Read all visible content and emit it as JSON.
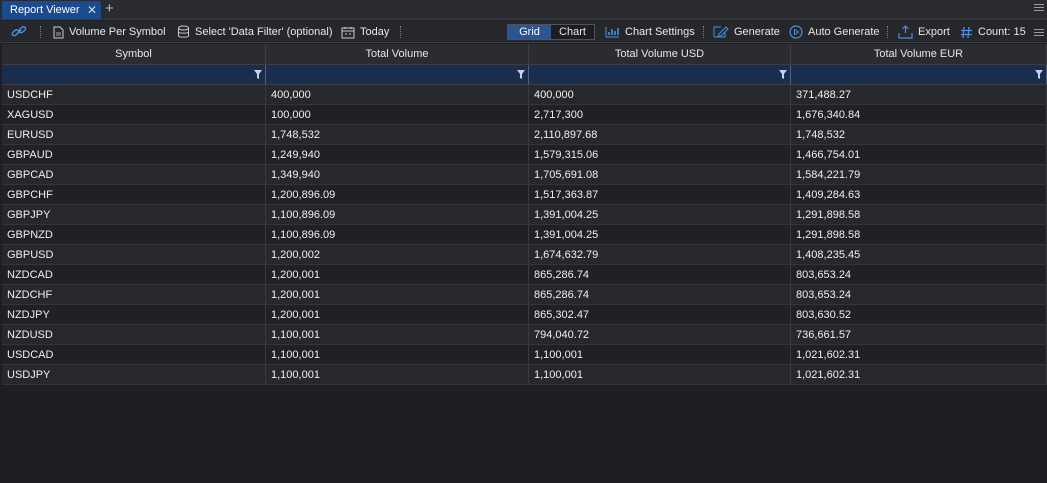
{
  "tabs": [
    {
      "label": "Report Viewer"
    }
  ],
  "toolbar": {
    "report_label": "Volume Per Symbol",
    "filter_label": "Select 'Data Filter' (optional)",
    "date_label": "Today",
    "view_grid": "Grid",
    "view_chart": "Chart",
    "chart_settings": "Chart Settings",
    "generate": "Generate",
    "auto_generate": "Auto Generate",
    "export": "Export",
    "count_label": "Count: 15"
  },
  "colors": {
    "accent": "#2c5392",
    "filter_row": "#1b2d4f",
    "icon_blue": "#4a90e2"
  },
  "table": {
    "columns": [
      "Symbol",
      "Total Volume",
      "Total Volume USD",
      "Total Volume EUR"
    ],
    "rows": [
      [
        "USDCHF",
        "400,000",
        "400,000",
        "371,488.27"
      ],
      [
        "XAGUSD",
        "100,000",
        "2,717,300",
        "1,676,340.84"
      ],
      [
        "EURUSD",
        "1,748,532",
        "2,110,897.68",
        "1,748,532"
      ],
      [
        "GBPAUD",
        "1,249,940",
        "1,579,315.06",
        "1,466,754.01"
      ],
      [
        "GBPCAD",
        "1,349,940",
        "1,705,691.08",
        "1,584,221.79"
      ],
      [
        "GBPCHF",
        "1,200,896.09",
        "1,517,363.87",
        "1,409,284.63"
      ],
      [
        "GBPJPY",
        "1,100,896.09",
        "1,391,004.25",
        "1,291,898.58"
      ],
      [
        "GBPNZD",
        "1,100,896.09",
        "1,391,004.25",
        "1,291,898.58"
      ],
      [
        "GBPUSD",
        "1,200,002",
        "1,674,632.79",
        "1,408,235.45"
      ],
      [
        "NZDCAD",
        "1,200,001",
        "865,286.74",
        "803,653.24"
      ],
      [
        "NZDCHF",
        "1,200,001",
        "865,286.74",
        "803,653.24"
      ],
      [
        "NZDJPY",
        "1,200,001",
        "865,302.47",
        "803,630.52"
      ],
      [
        "NZDUSD",
        "1,100,001",
        "794,040.72",
        "736,661.57"
      ],
      [
        "USDCAD",
        "1,100,001",
        "1,100,001",
        "1,021,602.31"
      ],
      [
        "USDJPY",
        "1,100,001",
        "1,100,001",
        "1,021,602.31"
      ]
    ]
  }
}
